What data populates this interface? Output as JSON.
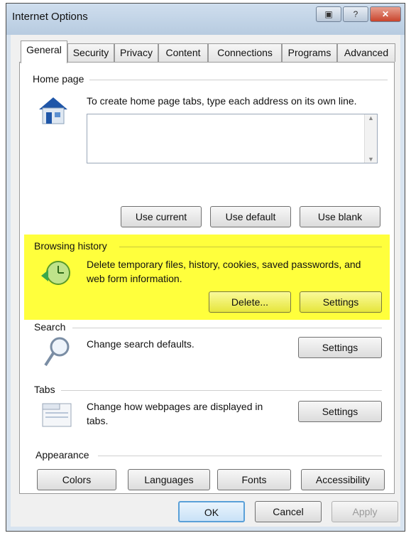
{
  "window": {
    "title": "Internet Options"
  },
  "tabs": [
    {
      "label": "General"
    },
    {
      "label": "Security"
    },
    {
      "label": "Privacy"
    },
    {
      "label": "Content"
    },
    {
      "label": "Connections"
    },
    {
      "label": "Programs"
    },
    {
      "label": "Advanced"
    }
  ],
  "home_page": {
    "label": "Home page",
    "description": "To create home page tabs, type each address on its own line.",
    "url_value": "",
    "buttons": {
      "use_current": "Use current",
      "use_default": "Use default",
      "use_blank": "Use blank"
    }
  },
  "browsing_history": {
    "label": "Browsing history",
    "description": "Delete temporary files, history, cookies, saved passwords, and web form information.",
    "delete_label": "Delete...",
    "settings_label": "Settings",
    "highlight_color": "#ffff3c"
  },
  "search": {
    "label": "Search",
    "description": "Change search defaults.",
    "settings_label": "Settings"
  },
  "tabs_section": {
    "label": "Tabs",
    "description": "Change how webpages are displayed in tabs.",
    "settings_label": "Settings"
  },
  "appearance": {
    "label": "Appearance",
    "buttons": {
      "colors": "Colors",
      "languages": "Languages",
      "fonts": "Fonts",
      "accessibility": "Accessibility"
    }
  },
  "footer": {
    "ok": "OK",
    "cancel": "Cancel",
    "apply": "Apply"
  },
  "icons": {
    "home": "house-icon",
    "history": "clock-icon",
    "search": "magnifier-icon",
    "tabs": "tabs-window-icon"
  }
}
